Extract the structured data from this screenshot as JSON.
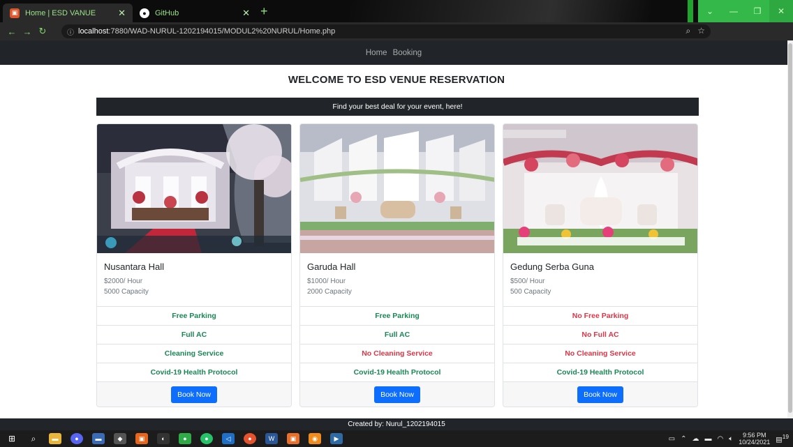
{
  "browser": {
    "tabs": [
      {
        "title": "Home | ESD VANUE",
        "icon": "esd-favicon-icon",
        "active": true
      },
      {
        "title": "GitHub",
        "icon": "github-favicon-icon",
        "active": false
      }
    ],
    "url_host": "localhost",
    "url_rest": ":7880/WAD-NURUL-1202194015/MODUL2%20NURUL/Home.php"
  },
  "navbar": {
    "links": [
      "Home",
      "Booking"
    ]
  },
  "heading": "WELCOME TO ESD VENUE RESERVATION",
  "tagline": "Find your best deal for your event, here!",
  "cards": [
    {
      "name": "Nusantara Hall",
      "price": "$2000/ Hour",
      "capacity": "5000 Capacity",
      "features": [
        {
          "label": "Free Parking",
          "available": true
        },
        {
          "label": "Full AC",
          "available": true
        },
        {
          "label": "Cleaning Service",
          "available": true
        },
        {
          "label": "Covid-19 Health Protocol",
          "available": true
        }
      ],
      "button": "Book Now"
    },
    {
      "name": "Garuda Hall",
      "price": "$1000/ Hour",
      "capacity": "2000 Capacity",
      "features": [
        {
          "label": "Free Parking",
          "available": true
        },
        {
          "label": "Full AC",
          "available": true
        },
        {
          "label": "No Cleaning Service",
          "available": false
        },
        {
          "label": "Covid-19 Health Protocol",
          "available": true
        }
      ],
      "button": "Book Now"
    },
    {
      "name": "Gedung Serba Guna",
      "price": "$500/ Hour",
      "capacity": "500 Capacity",
      "features": [
        {
          "label": "No Free Parking",
          "available": false
        },
        {
          "label": "No Full AC",
          "available": false
        },
        {
          "label": "No Cleaning Service",
          "available": false
        },
        {
          "label": "Covid-19 Health Protocol",
          "available": true
        }
      ],
      "button": "Book Now"
    }
  ],
  "footer": "Created by: Nurul_1202194015",
  "taskbar": {
    "time": "9:56 PM",
    "date": "10/24/2021",
    "notifications": "19"
  },
  "colors": {
    "dark": "#212529",
    "success": "#198754",
    "danger": "#dc3545",
    "primary": "#0d6efd",
    "browser_accent": "#35b84a"
  }
}
